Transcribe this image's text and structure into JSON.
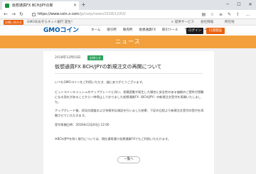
{
  "browser": {
    "tab_title": "仮想通貨FX BCH/JPYの新",
    "tab_close": "✕",
    "new_tab": "+",
    "url_main": "https://www.coin.z.com",
    "url_path": "/jp/corp/news/2018/12/03/",
    "win_min": "─",
    "win_max": "☐",
    "win_close": "✕"
  },
  "topstrip": {
    "badge": "お問い合わせ",
    "text": "GMOあおぞらネット銀行 誕生！",
    "links": [
      "ｓ 提供サービス",
      "会社情報",
      "所在地"
    ]
  },
  "header": {
    "logo_text": "GMOコイン",
    "nav": [
      "ホーム",
      "取引所",
      "販売所",
      "仮想通貨FX",
      "取引ツール",
      "サービスガイド ▾"
    ],
    "login": "ログイン",
    "open_account": "口座開設"
  },
  "banner": {
    "title": "ニュース"
  },
  "article": {
    "date": "2018年12月03日",
    "category": "お知らせ",
    "title": "仮想通貨FX BCH/JPYの新規注文の再開について",
    "paragraphs": [
      "いつもGMOコインをご利用いただき、誠にありがとうございます。",
      "ビットコインキャッシュのアップグレードに伴い、相場変動が発生した場合に安全性のある価格のご提供が困難になる恐れがあることから一時停止しておりました仮想通貨FX（BCH/JPY）の新規注文受付を再開いたしました。",
      "アップグレード後、状況の調査および技術的な検証を行いました結果、下記の日程より新規注文受付の受付を再開させていただきます。",
      "受付再開日時：2018年12月04日 12:00",
      "※BCH/JPYを除く取引については、現在通常通り仮想通貨FXでもご利用いただけます。"
    ],
    "back_button": "一覧へ"
  }
}
